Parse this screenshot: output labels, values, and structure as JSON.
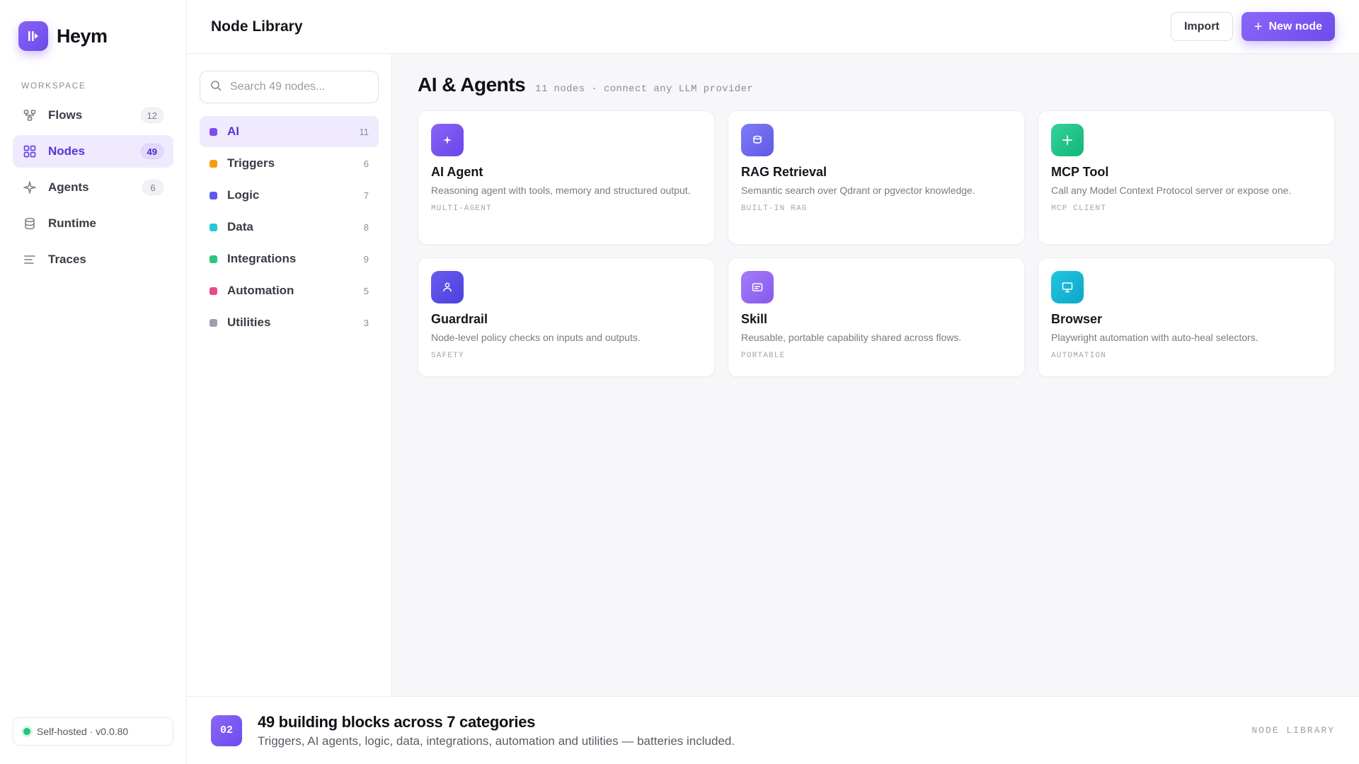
{
  "brand": {
    "name": "Heym",
    "logo_icon": "heym-logo-icon"
  },
  "sidebar": {
    "section_label": "WORKSPACE",
    "items": [
      {
        "label": "Flows",
        "count": "12",
        "icon": "flows-icon",
        "active": false
      },
      {
        "label": "Nodes",
        "count": "49",
        "icon": "nodes-grid-icon",
        "active": true
      },
      {
        "label": "Agents",
        "count": "6",
        "icon": "sparkle-icon",
        "active": false
      },
      {
        "label": "Runtime",
        "count": "",
        "icon": "database-icon",
        "active": false
      },
      {
        "label": "Traces",
        "count": "",
        "icon": "lines-icon",
        "active": false
      }
    ],
    "host_status": "Self-hosted · v0.0.80",
    "host_status_color": "#22c57a"
  },
  "header": {
    "title": "Node Library",
    "import_label": "Import",
    "new_node_label": "New node",
    "accent": "#7a56f3"
  },
  "search": {
    "placeholder": "Search 49 nodes..."
  },
  "categories": [
    {
      "label": "AI",
      "count": "11",
      "color": "#7c4df0",
      "active": true
    },
    {
      "label": "Triggers",
      "count": "6",
      "color": "#f59e0b",
      "active": false
    },
    {
      "label": "Logic",
      "count": "7",
      "color": "#5b5bf0",
      "active": false
    },
    {
      "label": "Data",
      "count": "8",
      "color": "#22c7d9",
      "active": false
    },
    {
      "label": "Integrations",
      "count": "9",
      "color": "#2ec47e",
      "active": false
    },
    {
      "label": "Automation",
      "count": "5",
      "color": "#e84a8a",
      "active": false
    },
    {
      "label": "Utilities",
      "count": "3",
      "color": "#9aa0ae",
      "active": false
    }
  ],
  "content": {
    "title": "AI & Agents",
    "subtitle": "11 nodes · connect any LLM provider",
    "cards": [
      {
        "title": "AI Agent",
        "desc": "Reasoning agent with tools, memory and structured output.",
        "tag": "MULTI-AGENT",
        "icon": "sparkle-icon",
        "color_from": "#8a63f7",
        "color_to": "#6a46e9"
      },
      {
        "title": "RAG Retrieval",
        "desc": "Semantic search over Qdrant or pgvector knowledge.",
        "tag": "BUILT-IN RAG",
        "icon": "database-icon",
        "color_from": "#7f7cf6",
        "color_to": "#5f58e6"
      },
      {
        "title": "MCP Tool",
        "desc": "Call any Model Context Protocol server or expose one.",
        "tag": "MCP CLIENT",
        "icon": "plus-icon",
        "color_from": "#34d399",
        "color_to": "#12b47a"
      },
      {
        "title": "Guardrail",
        "desc": "Node-level policy checks on inputs and outputs.",
        "tag": "SAFETY",
        "icon": "user-icon",
        "color_from": "#6a5cf0",
        "color_to": "#4c3fdc"
      },
      {
        "title": "Skill",
        "desc": "Reusable, portable capability shared across flows.",
        "tag": "PORTABLE",
        "icon": "card-icon",
        "color_from": "#a57cf9",
        "color_to": "#8559ee"
      },
      {
        "title": "Browser",
        "desc": "Playwright automation with auto-heal selectors.",
        "tag": "AUTOMATION",
        "icon": "monitor-icon",
        "color_from": "#22c7e0",
        "color_to": "#0ea5c9"
      }
    ]
  },
  "footer": {
    "step": "02",
    "title": "49 building blocks across 7 categories",
    "subtitle": "Triggers, AI agents, logic, data, integrations, automation and utilities — batteries included.",
    "tag": "NODE LIBRARY"
  }
}
